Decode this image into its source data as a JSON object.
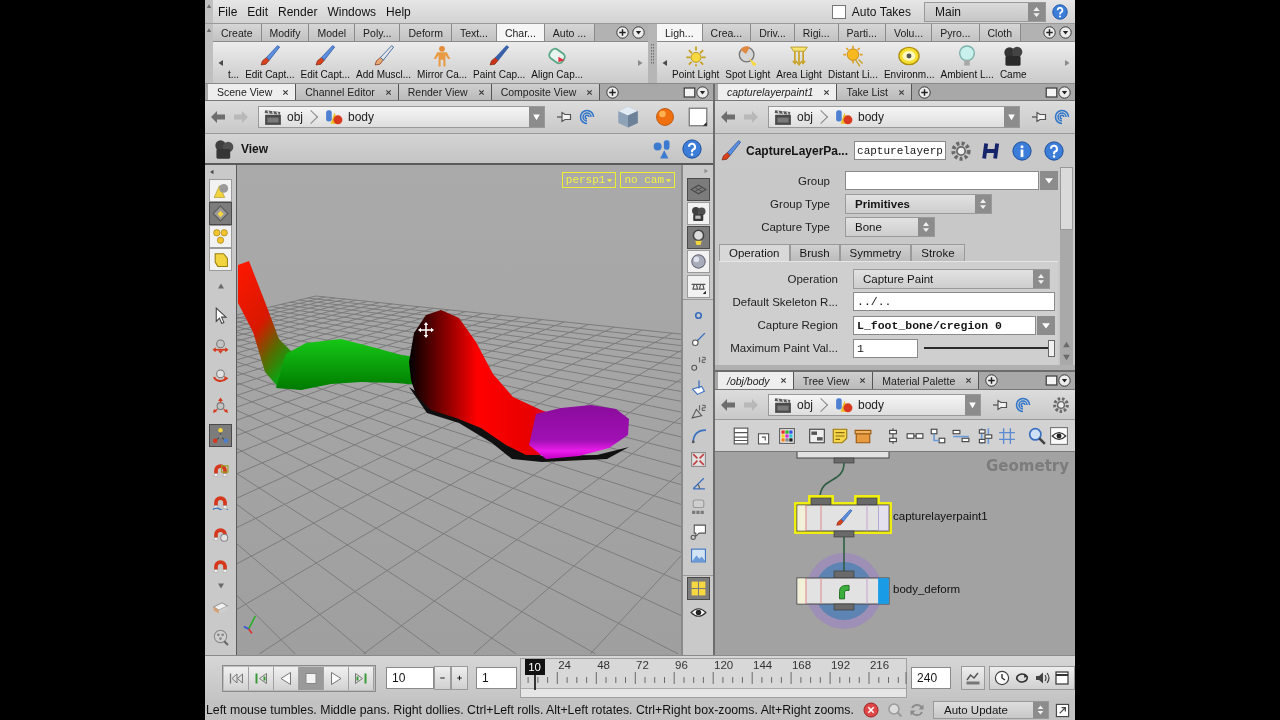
{
  "menu_bar": {
    "items": [
      "File",
      "Edit",
      "Render",
      "Windows",
      "Help"
    ],
    "auto_takes": {
      "label": "Auto Takes",
      "checked": false
    },
    "take": "Main"
  },
  "shelves": [
    {
      "tabs": [
        {
          "label": "Create",
          "selected": false
        },
        {
          "label": "Modify",
          "selected": false
        },
        {
          "label": "Model",
          "selected": false
        },
        {
          "label": "Poly...",
          "selected": false
        },
        {
          "label": "Deform",
          "selected": false
        },
        {
          "label": "Text...",
          "selected": false
        },
        {
          "label": "Char...",
          "selected": true
        },
        {
          "label": "Auto ...",
          "selected": false
        }
      ],
      "tools": [
        "t...",
        "Edit Capt...",
        "Edit Capt...",
        "Add Muscl...",
        "Mirror Ca...",
        "Paint Cap...",
        "Align Cap..."
      ]
    },
    {
      "tabs": [
        {
          "label": "Ligh...",
          "selected": true
        },
        {
          "label": "Crea...",
          "selected": false
        },
        {
          "label": "Driv...",
          "selected": false
        },
        {
          "label": "Rigi...",
          "selected": false
        },
        {
          "label": "Parti...",
          "selected": false
        },
        {
          "label": "Volu...",
          "selected": false
        },
        {
          "label": "Pyro...",
          "selected": false
        },
        {
          "label": "Cloth",
          "selected": false
        }
      ],
      "tools": [
        "Point Light",
        "Spot Light",
        "Area Light",
        "Distant Li...",
        "Environm...",
        "Ambient L...",
        "Came"
      ]
    }
  ],
  "scene_view": {
    "tabs": [
      {
        "label": "Scene View",
        "selected": true
      },
      {
        "label": "Channel Editor",
        "selected": false
      },
      {
        "label": "Render View",
        "selected": false
      },
      {
        "label": "Composite View",
        "selected": false
      }
    ],
    "path": [
      "obj",
      "body"
    ],
    "title": "View",
    "camera_menus": [
      "persp1",
      "no cam"
    ],
    "left_tools": [
      {
        "selected": false
      },
      {
        "selected": true
      },
      {
        "selected": false
      },
      {
        "selected": false
      },
      {
        "selected": false
      },
      {
        "selected": false
      },
      {
        "selected": false
      },
      {
        "selected": false
      },
      {
        "selected": true
      },
      {
        "selected": false
      },
      {
        "selected": false
      },
      {
        "selected": false
      },
      {
        "selected": false
      },
      {
        "selected": false
      },
      {
        "selected": false
      }
    ],
    "right_tools": [
      {
        "selected": true
      },
      {
        "selected": false
      },
      {
        "selected": true
      },
      {
        "selected": false
      },
      {
        "selected": false
      },
      {
        "selected": false
      },
      {
        "selected": false
      },
      {
        "selected": false
      },
      {
        "selected": false
      },
      {
        "selected": false
      },
      {
        "selected": false
      },
      {
        "selected": false
      },
      {
        "selected": false
      },
      {
        "selected": false
      },
      {
        "selected": false
      },
      {
        "selected": false
      },
      {
        "selected": true
      },
      {
        "selected": false
      }
    ]
  },
  "parameters": {
    "tabs": [
      {
        "label": "capturelayerpaint1",
        "selected": true
      },
      {
        "label": "Take List",
        "selected": false
      }
    ],
    "path": [
      "obj",
      "body"
    ],
    "node_type": "CaptureLayerPa...",
    "node_name": "capturelayerp",
    "params": [
      {
        "label": "Group",
        "kind": "field_menu"
      },
      {
        "label": "Group Type",
        "kind": "menu",
        "value": "Primitives",
        "changed": true
      },
      {
        "label": "Capture Type",
        "kind": "menu",
        "value": "Bone",
        "changed": false
      }
    ],
    "folder_tabs": [
      {
        "label": "Operation",
        "selected": true
      },
      {
        "label": "Brush",
        "selected": false
      },
      {
        "label": "Symmetry",
        "selected": false
      },
      {
        "label": "Stroke",
        "selected": false
      }
    ],
    "folder_params": [
      {
        "label": "Operation",
        "kind": "menu",
        "value": "Capture Paint",
        "changed": false
      },
      {
        "label": "Default Skeleton R...",
        "kind": "field",
        "value": "../..",
        "changed": false
      },
      {
        "label": "Capture Region",
        "kind": "field_menu",
        "value": "L_foot_bone/cregion 0",
        "changed": true
      },
      {
        "label": "Maximum Paint Val...",
        "kind": "slider",
        "value": "1",
        "changed": false,
        "level": 1
      }
    ]
  },
  "network": {
    "tabs": [
      {
        "label": "/obj/body",
        "selected": true
      },
      {
        "label": "Tree View",
        "selected": false
      },
      {
        "label": "Material Palette",
        "selected": false
      }
    ],
    "path": [
      "obj",
      "body"
    ],
    "context": "Geometry",
    "nodes": [
      {
        "name": "capturelayerpaint1",
        "selected": true,
        "display": false
      },
      {
        "name": "body_deform",
        "selected": false,
        "display": true
      }
    ]
  },
  "timeline": {
    "transport": [
      {
        "selected": false
      },
      {
        "selected": false
      },
      {
        "selected": false
      },
      {
        "selected": true
      },
      {
        "selected": false
      },
      {
        "selected": false
      }
    ],
    "frame": "10",
    "step": "1",
    "playhead": {
      "label": "10",
      "level": 0.038
    },
    "ticks": [
      "24",
      "48",
      "72",
      "96",
      "120",
      "144",
      "168",
      "192",
      "216"
    ],
    "end_frame": "240"
  },
  "status_bar": {
    "message": "Left mouse tumbles. Middle pans. Right dollies. Ctrl+Left rolls. Alt+Left rotates. Ctrl+Right box-zooms. Alt+Right zooms.",
    "update_mode": "Auto Update"
  }
}
